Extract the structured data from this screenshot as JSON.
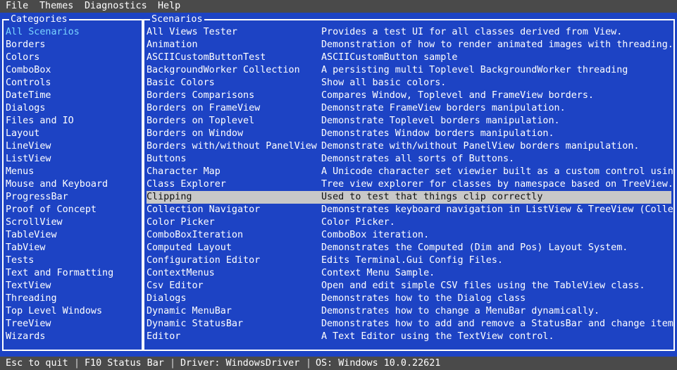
{
  "menu": [
    "File",
    "Themes",
    "Diagnostics",
    "Help"
  ],
  "categories": {
    "title": "Categories",
    "selected_index": 0,
    "items": [
      "All Scenarios",
      "Borders",
      "Colors",
      "ComboBox",
      "Controls",
      "DateTime",
      "Dialogs",
      "Files and IO",
      "Layout",
      "LineView",
      "ListView",
      "Menus",
      "Mouse and Keyboard",
      "ProgressBar",
      "Proof of Concept",
      "ScrollView",
      "TableView",
      "TabView",
      "Tests",
      "Text and Formatting",
      "TextView",
      "Threading",
      "Top Level Windows",
      "TreeView",
      "Wizards"
    ]
  },
  "scenarios": {
    "title": "Scenarios",
    "selected_index": 13,
    "items": [
      {
        "name": "All Views Tester",
        "desc": "Provides a test UI for all classes derived from View."
      },
      {
        "name": "Animation",
        "desc": "Demonstration of how to render animated images with threading."
      },
      {
        "name": "ASCIICustomButtonTest",
        "desc": "ASCIICustomButton sample"
      },
      {
        "name": "BackgroundWorker Collection",
        "desc": "A persisting multi Toplevel BackgroundWorker threading"
      },
      {
        "name": "Basic Colors",
        "desc": "Show all basic colors."
      },
      {
        "name": "Borders Comparisons",
        "desc": "Compares Window, Toplevel and FrameView borders."
      },
      {
        "name": "Borders on FrameView",
        "desc": "Demonstrate FrameView borders manipulation."
      },
      {
        "name": "Borders on Toplevel",
        "desc": "Demonstrate Toplevel borders manipulation."
      },
      {
        "name": "Borders on Window",
        "desc": "Demonstrates Window borders manipulation."
      },
      {
        "name": "Borders with/without PanelView",
        "desc": "Demonstrate with/without PanelView borders manipulation."
      },
      {
        "name": "Buttons",
        "desc": "Demonstrates all sorts of Buttons."
      },
      {
        "name": "Character Map",
        "desc": "A Unicode character set viewier built as a custom control usin"
      },
      {
        "name": "Class Explorer",
        "desc": "Tree view explorer for classes by namespace based on TreeView."
      },
      {
        "name": "Clipping",
        "desc": "Used to test that things clip correctly"
      },
      {
        "name": "Collection Navigator",
        "desc": "Demonstrates keyboard navigation in ListView & TreeView (Colle"
      },
      {
        "name": "Color Picker",
        "desc": "Color Picker."
      },
      {
        "name": "ComboBoxIteration",
        "desc": "ComboBox iteration."
      },
      {
        "name": "Computed Layout",
        "desc": "Demonstrates the Computed (Dim and Pos) Layout System."
      },
      {
        "name": "Configuration Editor",
        "desc": "Edits Terminal.Gui Config Files."
      },
      {
        "name": "ContextMenus",
        "desc": "Context Menu Sample."
      },
      {
        "name": "Csv Editor",
        "desc": "Open and edit simple CSV files using the TableView class."
      },
      {
        "name": "Dialogs",
        "desc": "Demonstrates how to the Dialog class"
      },
      {
        "name": "Dynamic MenuBar",
        "desc": "Demonstrates how to change a MenuBar dynamically."
      },
      {
        "name": "Dynamic StatusBar",
        "desc": "Demonstrates how to add and remove a StatusBar and change item"
      },
      {
        "name": "Editor",
        "desc": "A Text Editor using the TextView control."
      }
    ]
  },
  "status": {
    "items": [
      "Esc to quit",
      "F10 Status Bar",
      "Driver: WindowsDriver",
      "OS: Windows 10.0.22621"
    ],
    "separator": "|"
  },
  "colors": {
    "background": "#1d43c4",
    "bar": "#4a4a4a",
    "selected_category": "#7ad5ff",
    "selected_row_bg": "#c8c8c8"
  }
}
